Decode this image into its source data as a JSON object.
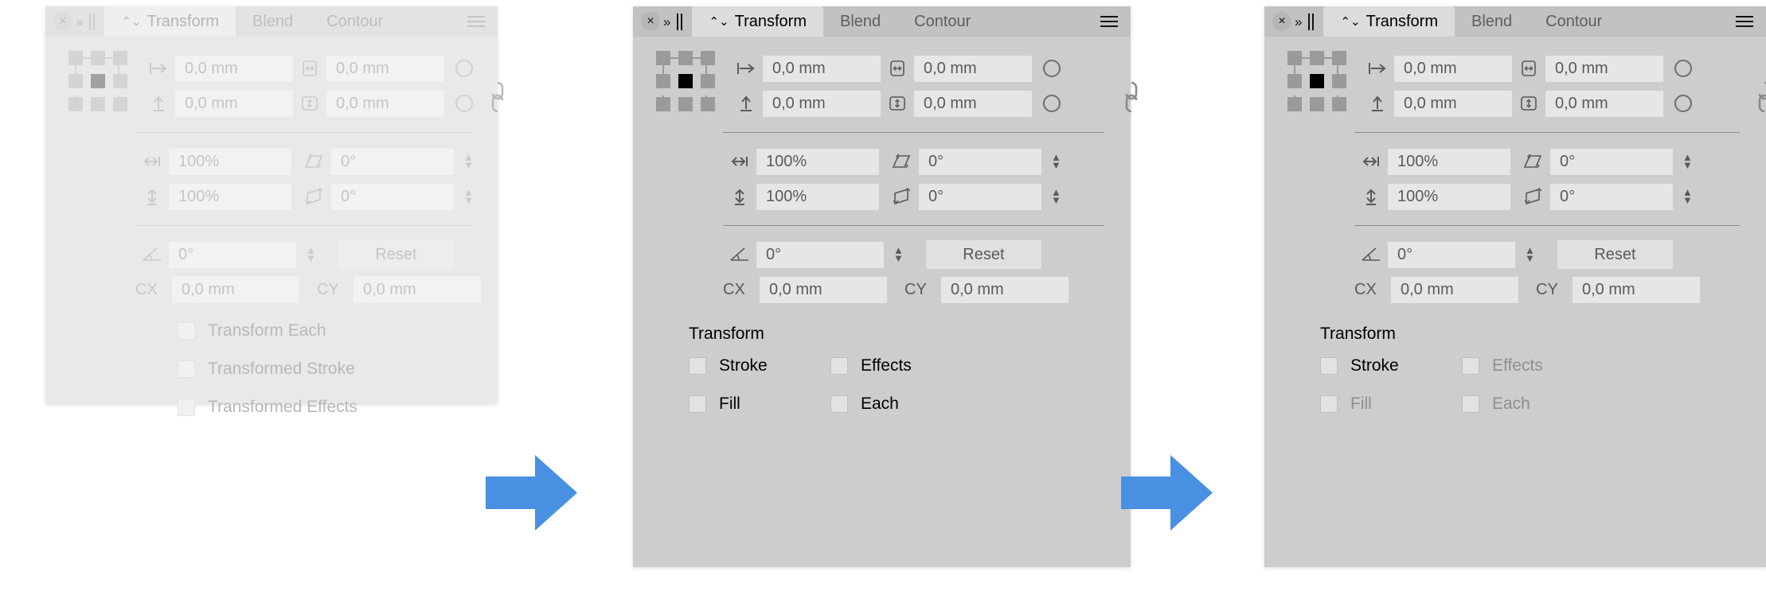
{
  "panels": [
    {
      "id": "panel-faded",
      "state": "faded",
      "titlebar": {
        "close_label": "×",
        "collapse_label": "»",
        "grip_label": "||",
        "menu_label": "☰"
      },
      "tabs": [
        {
          "label": "Transform",
          "sort_glyph": "⌃⌄",
          "active": true
        },
        {
          "label": "Blend",
          "active": false
        },
        {
          "label": "Contour",
          "active": false
        }
      ],
      "position": {
        "x_icon": "align-left-icon",
        "x_value": "0,0 mm",
        "w_icon": "width-icon",
        "w_value": "0,0 mm",
        "y_icon": "align-top-icon",
        "y_value": "0,0 mm",
        "h_icon": "height-icon",
        "h_value": "0,0 mm",
        "lock_icon": "chain-link-icon"
      },
      "scale": {
        "w_icon": "scale-horizontal-icon",
        "w_value": "100%",
        "shear_icon": "shear-horizontal-icon",
        "shear_value": "0°",
        "h_icon": "scale-vertical-icon",
        "h_value": "100%",
        "shear2_icon": "shear-vertical-icon",
        "shear2_value": "0°"
      },
      "rotation": {
        "icon": "angle-icon",
        "value": "0°",
        "reset_label": "Reset",
        "cx_label": "CX",
        "cx_value": "0,0 mm",
        "cy_label": "CY",
        "cy_value": "0,0 mm"
      },
      "section_title": "",
      "checkboxes": [
        {
          "label": "Transform Each",
          "checked": false,
          "dim": false
        },
        {
          "label": "Transformed Stroke",
          "checked": false,
          "dim": false
        },
        {
          "label": "Transformed Effects",
          "checked": false,
          "dim": false
        }
      ]
    },
    {
      "id": "panel-active",
      "state": "active",
      "titlebar": {
        "close_label": "×",
        "collapse_label": "»",
        "grip_label": "||",
        "menu_label": "☰"
      },
      "tabs": [
        {
          "label": "Transform",
          "sort_glyph": "⌃⌄",
          "active": true
        },
        {
          "label": "Blend",
          "active": false
        },
        {
          "label": "Contour",
          "active": false
        }
      ],
      "position": {
        "x_icon": "align-left-icon",
        "x_value": "0,0 mm",
        "w_icon": "width-icon",
        "w_value": "0,0 mm",
        "y_icon": "align-top-icon",
        "y_value": "0,0 mm",
        "h_icon": "height-icon",
        "h_value": "0,0 mm",
        "lock_icon": "chain-link-icon"
      },
      "scale": {
        "w_icon": "scale-horizontal-icon",
        "w_value": "100%",
        "shear_icon": "shear-horizontal-icon",
        "shear_value": "0°",
        "h_icon": "scale-vertical-icon",
        "h_value": "100%",
        "shear2_icon": "shear-vertical-icon",
        "shear2_value": "0°"
      },
      "rotation": {
        "icon": "angle-icon",
        "value": "0°",
        "reset_label": "Reset",
        "cx_label": "CX",
        "cx_value": "0,0 mm",
        "cy_label": "CY",
        "cy_value": "0,0 mm"
      },
      "section_title": "Transform",
      "checkboxes": [
        {
          "label": "Stroke",
          "checked": false,
          "dim": false
        },
        {
          "label": "Effects",
          "checked": false,
          "dim": false
        },
        {
          "label": "Fill",
          "checked": false,
          "dim": false
        },
        {
          "label": "Each",
          "checked": false,
          "dim": false
        }
      ]
    },
    {
      "id": "panel-partial",
      "state": "partial",
      "titlebar": {
        "close_label": "×",
        "collapse_label": "»",
        "grip_label": "||",
        "menu_label": "☰"
      },
      "tabs": [
        {
          "label": "Transform",
          "sort_glyph": "⌃⌄",
          "active": true
        },
        {
          "label": "Blend",
          "active": false
        },
        {
          "label": "Contour",
          "active": false
        }
      ],
      "position": {
        "x_icon": "align-left-icon",
        "x_value": "0,0 mm",
        "w_icon": "width-icon",
        "w_value": "0,0 mm",
        "y_icon": "align-top-icon",
        "y_value": "0,0 mm",
        "h_icon": "height-icon",
        "h_value": "0,0 mm",
        "lock_icon": "chain-link-icon"
      },
      "scale": {
        "w_icon": "scale-horizontal-icon",
        "w_value": "100%",
        "shear_icon": "shear-horizontal-icon",
        "shear_value": "0°",
        "h_icon": "scale-vertical-icon",
        "h_value": "100%",
        "shear2_icon": "shear-vertical-icon",
        "shear2_value": "0°"
      },
      "rotation": {
        "icon": "angle-icon",
        "value": "0°",
        "reset_label": "Reset",
        "cx_label": "CX",
        "cx_value": "0,0 mm",
        "cy_label": "CY",
        "cy_value": "0,0 mm"
      },
      "section_title": "Transform",
      "checkboxes": [
        {
          "label": "Stroke",
          "checked": false,
          "dim": false
        },
        {
          "label": "Effects",
          "checked": false,
          "dim": true
        },
        {
          "label": "Fill",
          "checked": false,
          "dim": true
        },
        {
          "label": "Each",
          "checked": false,
          "dim": true
        }
      ]
    }
  ],
  "arrows": [
    {
      "name": "flow-arrow-1",
      "glyph": "→"
    },
    {
      "name": "flow-arrow-2",
      "glyph": "→"
    }
  ],
  "colors": {
    "arrow_blue": "#4a90e2",
    "panel_faded_bg": "#e8eae9",
    "panel_active_bg": "#cdcdcd",
    "titlebar_active_bg": "#c2c2c2",
    "tab_active_bg": "#dcdcdc",
    "field_bg": "#e6e6e6"
  }
}
